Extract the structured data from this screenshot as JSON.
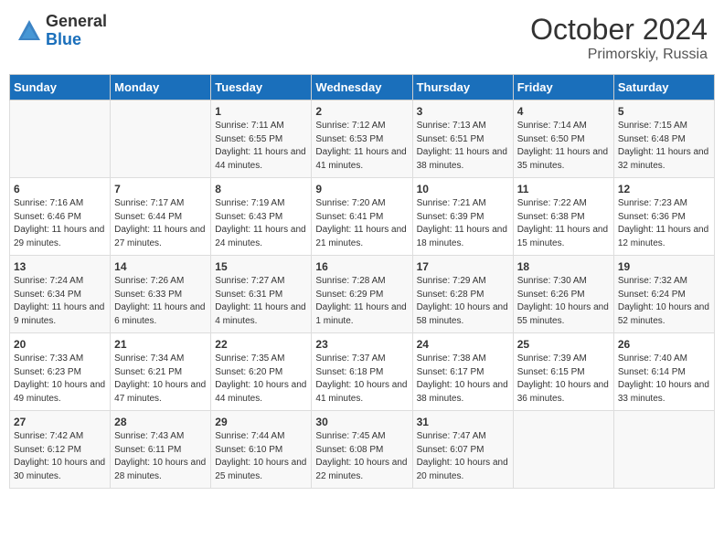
{
  "header": {
    "logo_general": "General",
    "logo_blue": "Blue",
    "month": "October 2024",
    "location": "Primorskiy, Russia"
  },
  "weekdays": [
    "Sunday",
    "Monday",
    "Tuesday",
    "Wednesday",
    "Thursday",
    "Friday",
    "Saturday"
  ],
  "weeks": [
    [
      {
        "day": "",
        "info": ""
      },
      {
        "day": "",
        "info": ""
      },
      {
        "day": "1",
        "info": "Sunrise: 7:11 AM\nSunset: 6:55 PM\nDaylight: 11 hours and 44 minutes."
      },
      {
        "day": "2",
        "info": "Sunrise: 7:12 AM\nSunset: 6:53 PM\nDaylight: 11 hours and 41 minutes."
      },
      {
        "day": "3",
        "info": "Sunrise: 7:13 AM\nSunset: 6:51 PM\nDaylight: 11 hours and 38 minutes."
      },
      {
        "day": "4",
        "info": "Sunrise: 7:14 AM\nSunset: 6:50 PM\nDaylight: 11 hours and 35 minutes."
      },
      {
        "day": "5",
        "info": "Sunrise: 7:15 AM\nSunset: 6:48 PM\nDaylight: 11 hours and 32 minutes."
      }
    ],
    [
      {
        "day": "6",
        "info": "Sunrise: 7:16 AM\nSunset: 6:46 PM\nDaylight: 11 hours and 29 minutes."
      },
      {
        "day": "7",
        "info": "Sunrise: 7:17 AM\nSunset: 6:44 PM\nDaylight: 11 hours and 27 minutes."
      },
      {
        "day": "8",
        "info": "Sunrise: 7:19 AM\nSunset: 6:43 PM\nDaylight: 11 hours and 24 minutes."
      },
      {
        "day": "9",
        "info": "Sunrise: 7:20 AM\nSunset: 6:41 PM\nDaylight: 11 hours and 21 minutes."
      },
      {
        "day": "10",
        "info": "Sunrise: 7:21 AM\nSunset: 6:39 PM\nDaylight: 11 hours and 18 minutes."
      },
      {
        "day": "11",
        "info": "Sunrise: 7:22 AM\nSunset: 6:38 PM\nDaylight: 11 hours and 15 minutes."
      },
      {
        "day": "12",
        "info": "Sunrise: 7:23 AM\nSunset: 6:36 PM\nDaylight: 11 hours and 12 minutes."
      }
    ],
    [
      {
        "day": "13",
        "info": "Sunrise: 7:24 AM\nSunset: 6:34 PM\nDaylight: 11 hours and 9 minutes."
      },
      {
        "day": "14",
        "info": "Sunrise: 7:26 AM\nSunset: 6:33 PM\nDaylight: 11 hours and 6 minutes."
      },
      {
        "day": "15",
        "info": "Sunrise: 7:27 AM\nSunset: 6:31 PM\nDaylight: 11 hours and 4 minutes."
      },
      {
        "day": "16",
        "info": "Sunrise: 7:28 AM\nSunset: 6:29 PM\nDaylight: 11 hours and 1 minute."
      },
      {
        "day": "17",
        "info": "Sunrise: 7:29 AM\nSunset: 6:28 PM\nDaylight: 10 hours and 58 minutes."
      },
      {
        "day": "18",
        "info": "Sunrise: 7:30 AM\nSunset: 6:26 PM\nDaylight: 10 hours and 55 minutes."
      },
      {
        "day": "19",
        "info": "Sunrise: 7:32 AM\nSunset: 6:24 PM\nDaylight: 10 hours and 52 minutes."
      }
    ],
    [
      {
        "day": "20",
        "info": "Sunrise: 7:33 AM\nSunset: 6:23 PM\nDaylight: 10 hours and 49 minutes."
      },
      {
        "day": "21",
        "info": "Sunrise: 7:34 AM\nSunset: 6:21 PM\nDaylight: 10 hours and 47 minutes."
      },
      {
        "day": "22",
        "info": "Sunrise: 7:35 AM\nSunset: 6:20 PM\nDaylight: 10 hours and 44 minutes."
      },
      {
        "day": "23",
        "info": "Sunrise: 7:37 AM\nSunset: 6:18 PM\nDaylight: 10 hours and 41 minutes."
      },
      {
        "day": "24",
        "info": "Sunrise: 7:38 AM\nSunset: 6:17 PM\nDaylight: 10 hours and 38 minutes."
      },
      {
        "day": "25",
        "info": "Sunrise: 7:39 AM\nSunset: 6:15 PM\nDaylight: 10 hours and 36 minutes."
      },
      {
        "day": "26",
        "info": "Sunrise: 7:40 AM\nSunset: 6:14 PM\nDaylight: 10 hours and 33 minutes."
      }
    ],
    [
      {
        "day": "27",
        "info": "Sunrise: 7:42 AM\nSunset: 6:12 PM\nDaylight: 10 hours and 30 minutes."
      },
      {
        "day": "28",
        "info": "Sunrise: 7:43 AM\nSunset: 6:11 PM\nDaylight: 10 hours and 28 minutes."
      },
      {
        "day": "29",
        "info": "Sunrise: 7:44 AM\nSunset: 6:10 PM\nDaylight: 10 hours and 25 minutes."
      },
      {
        "day": "30",
        "info": "Sunrise: 7:45 AM\nSunset: 6:08 PM\nDaylight: 10 hours and 22 minutes."
      },
      {
        "day": "31",
        "info": "Sunrise: 7:47 AM\nSunset: 6:07 PM\nDaylight: 10 hours and 20 minutes."
      },
      {
        "day": "",
        "info": ""
      },
      {
        "day": "",
        "info": ""
      }
    ]
  ]
}
